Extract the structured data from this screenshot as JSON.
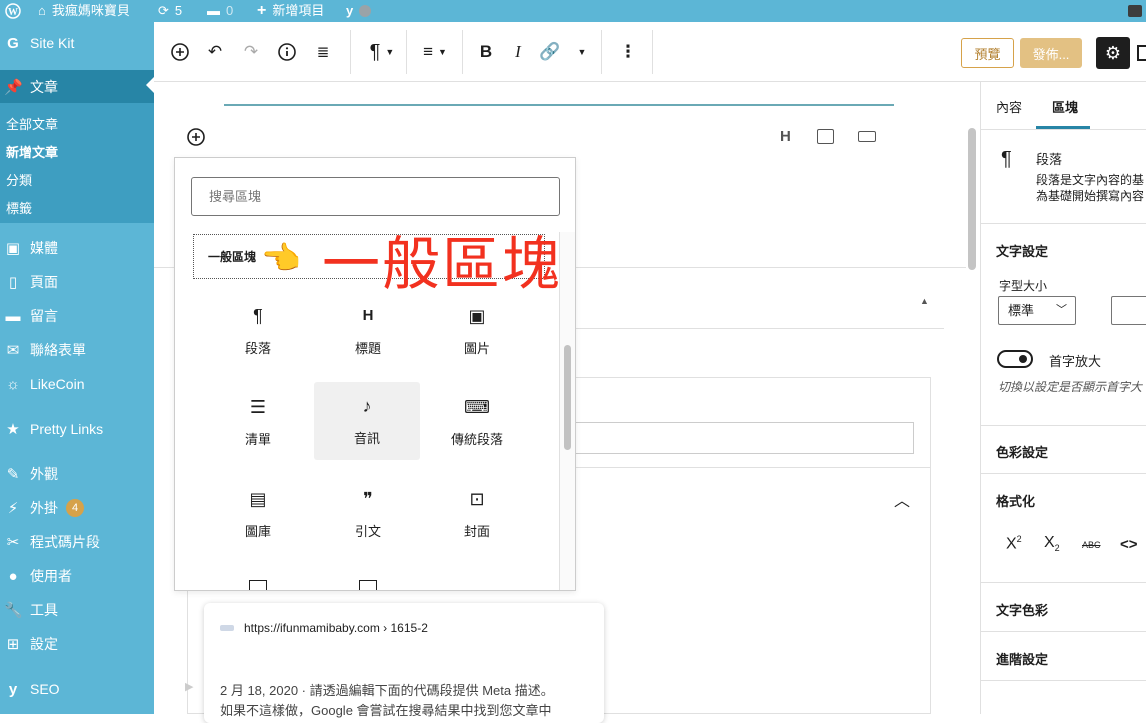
{
  "adminbar": {
    "site_name": "我瘋媽咪寶貝",
    "updates_count": "5",
    "comments_count": "0",
    "new_item": "新增項目"
  },
  "sidebar": {
    "site_kit": "Site Kit",
    "posts": "文章",
    "posts_sub": [
      "全部文章",
      "新增文章",
      "分類",
      "標籤"
    ],
    "media": "媒體",
    "pages": "頁面",
    "comments": "留言",
    "contact": "聯絡表單",
    "likecoin": "LikeCoin",
    "pretty_links": "Pretty Links",
    "appearance": "外觀",
    "plugins": "外掛",
    "plugins_badge": "4",
    "snippets": "程式碼片段",
    "users": "使用者",
    "tools": "工具",
    "settings": "設定",
    "seo": "SEO"
  },
  "toolbar": {
    "preview": "預覽",
    "publish": "發佈..."
  },
  "inserter": {
    "search_placeholder": "搜尋區塊",
    "category": "一般區塊",
    "blocks": [
      {
        "label": "段落",
        "icon": "¶"
      },
      {
        "label": "標題",
        "icon": "H"
      },
      {
        "label": "圖片",
        "icon": "▣"
      },
      {
        "label": "清單",
        "icon": "☰"
      },
      {
        "label": "音訊",
        "icon": "♪"
      },
      {
        "label": "傳統段落",
        "icon": "⌨"
      },
      {
        "label": "圖庫",
        "icon": "▤"
      },
      {
        "label": "引文",
        "icon": "❞"
      },
      {
        "label": "封面",
        "icon": "⊡"
      }
    ]
  },
  "annotation": "一般區塊",
  "seo_preview": {
    "url": "https://ifunmamibaby.com › 1615-2",
    "line1": "2 月 18, 2020 · 請透過編輯下面的代碼段提供 Meta 描述。",
    "line2": "如果不這樣做，Google 會嘗試在搜尋結果中找到您文章中"
  },
  "panel": {
    "tab_content": "內容",
    "tab_block": "區塊",
    "block_name": "段落",
    "block_desc1": "段落是文字內容的基",
    "block_desc2": "為基礎開始撰寫內容",
    "text_settings": "文字設定",
    "font_size": "字型大小",
    "font_size_value": "標準",
    "drop_cap": "首字放大",
    "drop_cap_help": "切換以設定是否顯示首字大",
    "color_settings": "色彩設定",
    "formatting": "格式化",
    "text_color": "文字色彩",
    "advanced": "進階設定"
  }
}
